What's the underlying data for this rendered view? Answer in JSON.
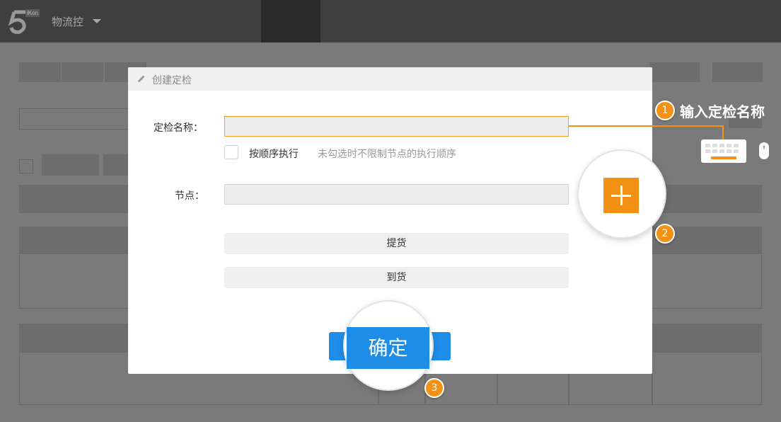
{
  "app": {
    "name": "物流控",
    "logo_badge": "iKon"
  },
  "modal": {
    "title": "创建定检",
    "name_label": "定检名称：",
    "name_value": "",
    "sequential_label": "按顺序执行",
    "sequential_checked": false,
    "sequential_hint": "未勾选时不限制节点的执行顺序",
    "node_label": "节点：",
    "node_value": "",
    "options": [
      "提货",
      "到货"
    ],
    "confirm_label": "确定"
  },
  "annotations": {
    "step1": {
      "number": "1",
      "text": "输入定检名称"
    },
    "step2": {
      "number": "2"
    },
    "step3": {
      "number": "3"
    }
  },
  "colors": {
    "accent": "#f29113",
    "primary": "#1e8de8",
    "overlay": "#7a7a7a"
  },
  "icons": [
    "pencil-icon",
    "keyboard-icon",
    "mouse-icon",
    "plus-icon",
    "chevron-down-icon"
  ]
}
